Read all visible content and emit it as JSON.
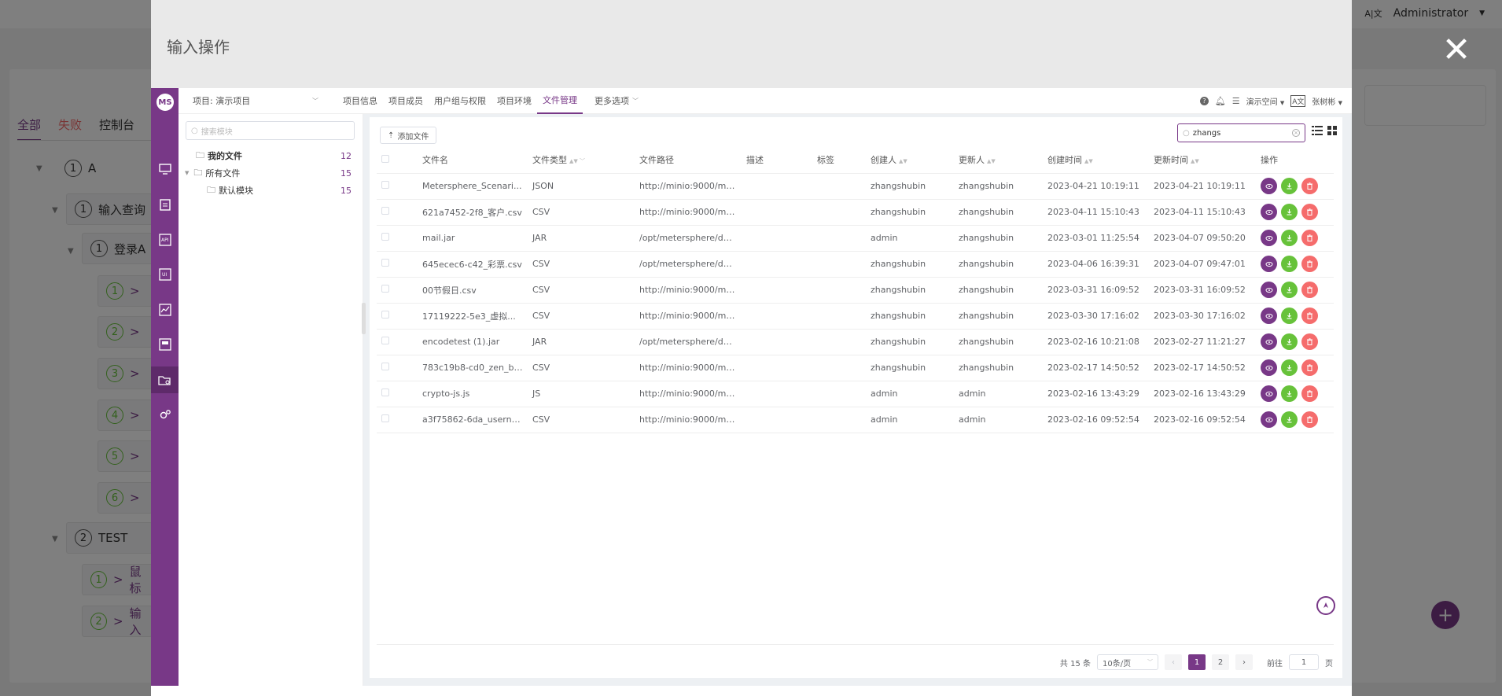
{
  "background": {
    "user": "Administrator",
    "tabs": [
      "全部",
      "失败",
      "控制台"
    ],
    "rows": [
      {
        "num": "1",
        "label": "A"
      },
      {
        "num": "1",
        "label": "输入查询"
      },
      {
        "num": "1",
        "label": "登录A"
      },
      {
        "num": "2",
        "label": "TEST"
      },
      {
        "num": "1",
        "label": "鼠标"
      },
      {
        "num": "2",
        "label": "输入"
      }
    ],
    "steps": [
      "1",
      "2",
      "3",
      "4",
      "5",
      "6"
    ]
  },
  "drawer": {
    "title": "输入操作"
  },
  "app": {
    "logo": "MS",
    "project_selector": "项目: 演示项目",
    "nav": [
      {
        "label": "项目信息",
        "active": false
      },
      {
        "label": "项目成员",
        "active": false
      },
      {
        "label": "用户组与权限",
        "active": false
      },
      {
        "label": "项目环境",
        "active": false
      },
      {
        "label": "文件管理",
        "active": true
      },
      {
        "label": "更多选项",
        "active": false
      }
    ],
    "workspace": "演示空间",
    "user": "张树彬"
  },
  "tree": {
    "search_placeholder": "搜索模块",
    "nodes": [
      {
        "label": "我的文件",
        "count": "12"
      },
      {
        "label": "所有文件",
        "count": "15"
      },
      {
        "label": "默认模块",
        "count": "15"
      }
    ]
  },
  "toolbar": {
    "add_file": "添加文件",
    "search_value": "zhangs"
  },
  "table": {
    "headers": [
      "文件名",
      "文件类型",
      "文件路径",
      "描述",
      "标签",
      "创建人",
      "更新人",
      "创建时间",
      "更新时间",
      "操作"
    ],
    "rows": [
      [
        "Metersphere_Scenari...",
        "JSON",
        "http://minio:9000/met...",
        "",
        "",
        "zhangshubin",
        "zhangshubin",
        "2023-04-21 10:19:11",
        "2023-04-21 10:19:11"
      ],
      [
        "621a7452-2f8_客户.csv",
        "CSV",
        "http://minio:9000/met...",
        "",
        "",
        "zhangshubin",
        "zhangshubin",
        "2023-04-11 15:10:43",
        "2023-04-11 15:10:43"
      ],
      [
        "mail.jar",
        "JAR",
        "/opt/metersphere/dat...",
        "",
        "",
        "admin",
        "zhangshubin",
        "2023-03-01 11:25:54",
        "2023-04-07 09:50:20"
      ],
      [
        "645ecec6-c42_彩票.csv",
        "CSV",
        "/opt/metersphere/dat...",
        "",
        "",
        "zhangshubin",
        "zhangshubin",
        "2023-04-06 16:39:31",
        "2023-04-07 09:47:01"
      ],
      [
        "00节假日.csv",
        "CSV",
        "http://minio:9000/met...",
        "",
        "",
        "zhangshubin",
        "zhangshubin",
        "2023-03-31 16:09:52",
        "2023-03-31 16:09:52"
      ],
      [
        "17119222-5e3_虚拟...",
        "CSV",
        "http://minio:9000/met...",
        "",
        "",
        "zhangshubin",
        "zhangshubin",
        "2023-03-30 17:16:02",
        "2023-03-30 17:16:02"
      ],
      [
        "encodetest (1).jar",
        "JAR",
        "/opt/metersphere/dat...",
        "",
        "",
        "zhangshubin",
        "zhangshubin",
        "2023-02-16 10:21:08",
        "2023-02-27 11:21:27"
      ],
      [
        "783c19b8-cd0_zen_bf...",
        "CSV",
        "http://minio:9000/met...",
        "",
        "",
        "zhangshubin",
        "zhangshubin",
        "2023-02-17 14:50:52",
        "2023-02-17 14:50:52"
      ],
      [
        "crypto-js.js",
        "JS",
        "http://minio:9000/met...",
        "",
        "",
        "admin",
        "admin",
        "2023-02-16 13:43:29",
        "2023-02-16 13:43:29"
      ],
      [
        "a3f75862-6da_userna...",
        "CSV",
        "http://minio:9000/met...",
        "",
        "",
        "admin",
        "admin",
        "2023-02-16 09:52:54",
        "2023-02-16 09:52:54"
      ]
    ]
  },
  "pagination": {
    "total": "共 15 条",
    "page_size": "10条/页",
    "pages": [
      "1",
      "2"
    ],
    "current": "1",
    "goto_prefix": "前往",
    "goto_value": "1",
    "goto_suffix": "页"
  },
  "colors": {
    "brand": "#783887",
    "success": "#67c23a",
    "danger": "#f56c6c"
  }
}
